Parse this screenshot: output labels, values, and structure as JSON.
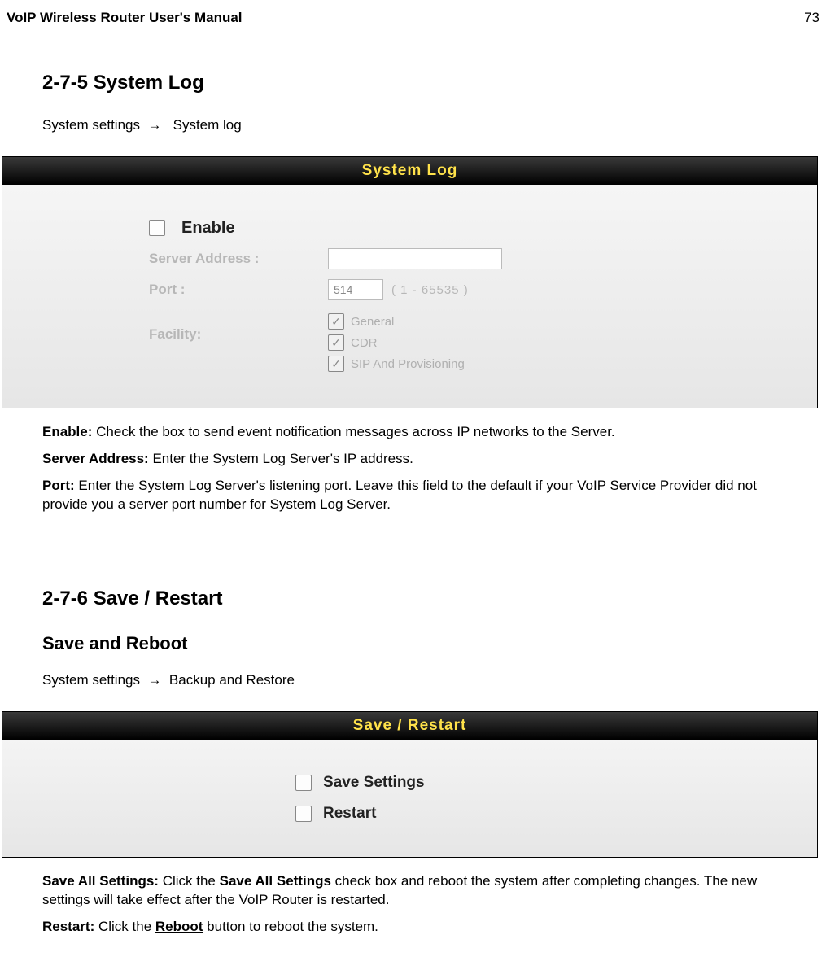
{
  "doc_header": {
    "title": "VoIP Wireless Router User's Manual",
    "page": "73"
  },
  "section1": {
    "heading": "2-7-5 System Log",
    "breadcrumb_a": "System settings",
    "breadcrumb_arrow": "→",
    "breadcrumb_b": "System log"
  },
  "panel1": {
    "title": "System Log",
    "enable_label": "Enable",
    "server_label": "Server Address :",
    "port_label": "Port :",
    "port_value": "514",
    "port_hint": "( 1 - 65535 )",
    "facility_label": "Facility:",
    "facility_items": [
      "General",
      "CDR",
      "SIP And Provisioning"
    ]
  },
  "desc1": {
    "enable_b": "Enable:",
    "enable_t": " Check the box to send event notification messages across IP networks to the Server.",
    "server_b": "Server Address:",
    "server_t": " Enter the System Log Server's IP address.",
    "port_b": "Port:",
    "port_t": " Enter the System Log Server's listening port. Leave this field to the default if your VoIP Service Provider did not provide you a server port number for System Log Server."
  },
  "section2": {
    "heading": "2-7-6 Save / Restart",
    "subheading": "Save and Reboot",
    "breadcrumb_a": "System settings",
    "breadcrumb_arrow": "→",
    "breadcrumb_b": "Backup and Restore"
  },
  "panel2": {
    "title": "Save / Restart",
    "save_label": "Save Settings",
    "restart_label": "Restart"
  },
  "desc2": {
    "save_b": "Save All Settings:",
    "save_t1": " Click the ",
    "save_b2": "Save All Settings",
    "save_t2": " check box and reboot the system after completing changes. The new settings will take effect after the VoIP Router is restarted.",
    "restart_b": "Restart:",
    "restart_t1": " Click the ",
    "restart_b2": "Reboot",
    "restart_t2": " button to reboot the system."
  }
}
